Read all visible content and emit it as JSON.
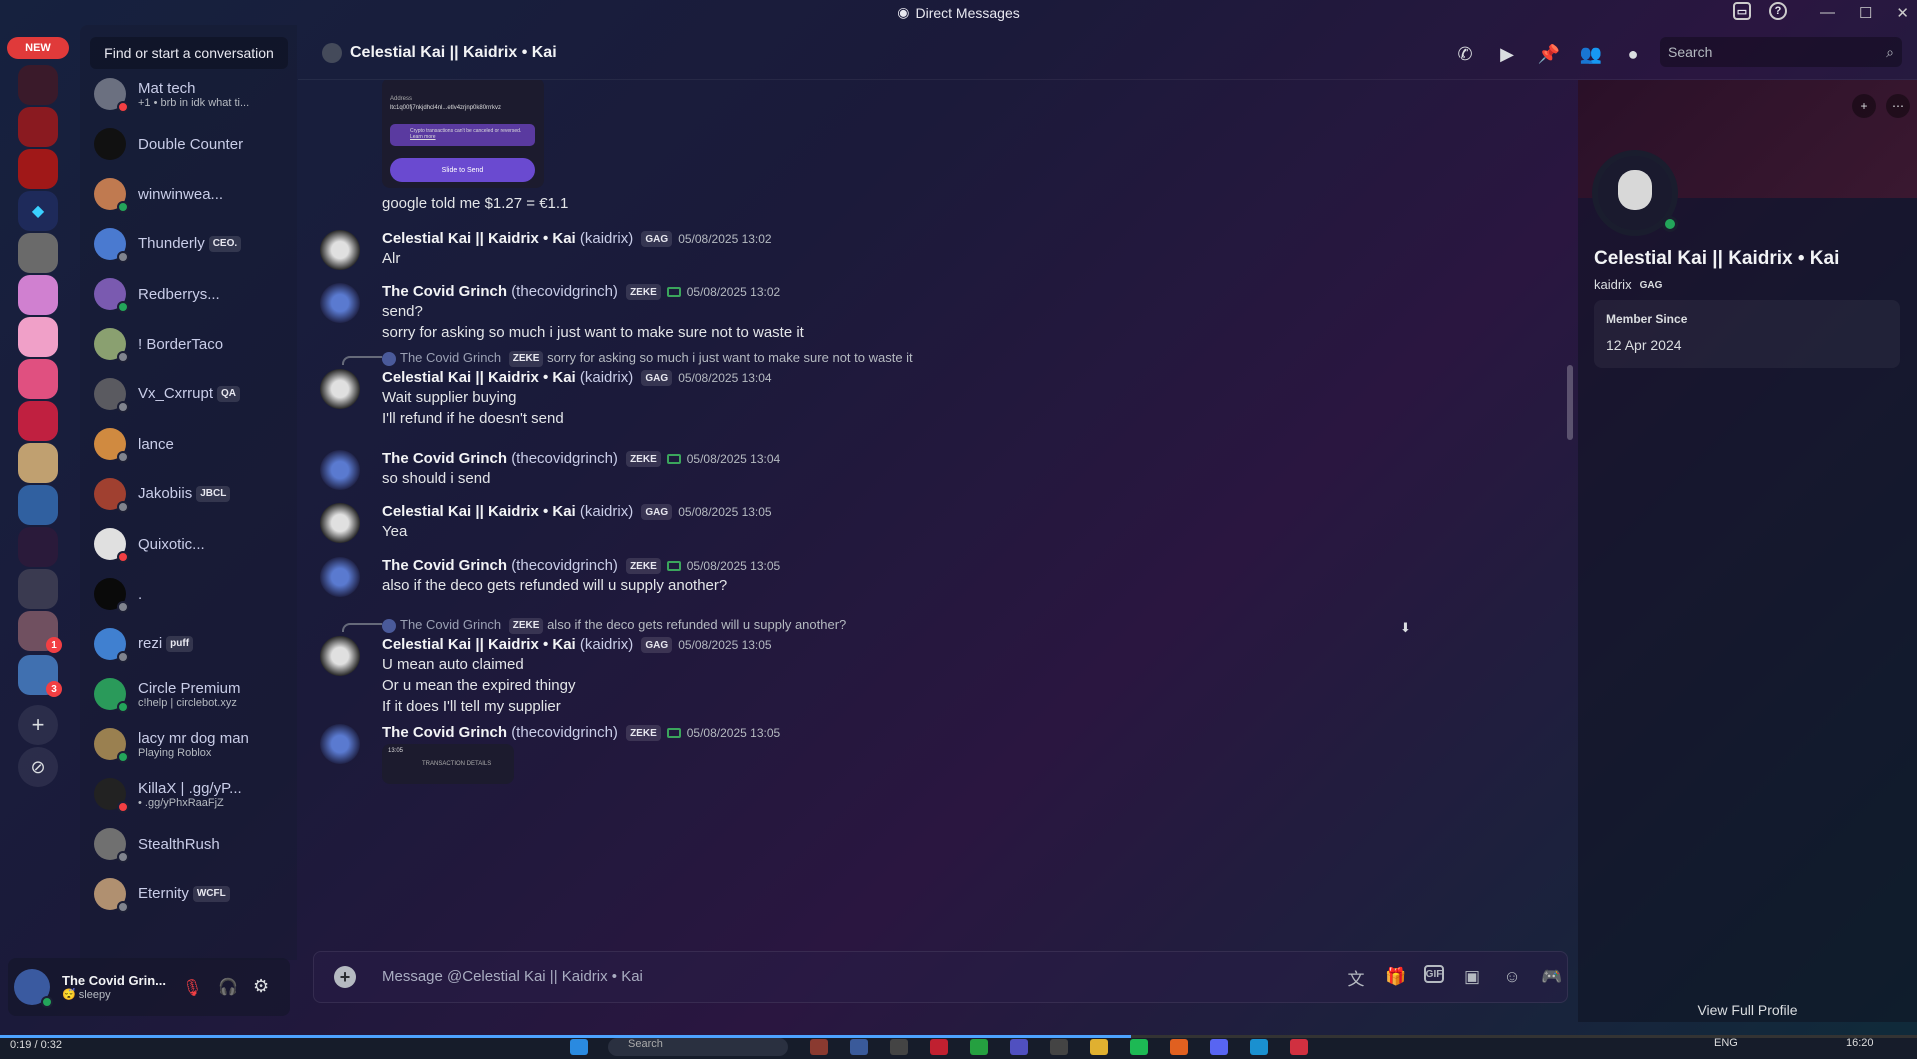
{
  "window": {
    "title": "Direct Messages"
  },
  "servers": {
    "new_label": "NEW",
    "badges": [
      "1",
      "3"
    ]
  },
  "dm_list": {
    "find_placeholder": "Find or start a conversation",
    "items": [
      {
        "name": "Mat tech",
        "sub": "+1 • brb in idk what ti...",
        "status": "dnd",
        "color": "#6b7080"
      },
      {
        "name": "Double Counter",
        "sub": "",
        "status": "none",
        "color": "#111111"
      },
      {
        "name": "winwinwea...",
        "sub": "",
        "status": "on",
        "color": "#c07a50"
      },
      {
        "name": "Thunderly",
        "tag": "CEO.",
        "sub": "",
        "status": "off",
        "color": "#4a7ad0"
      },
      {
        "name": "Redberrys...",
        "sub": "",
        "status": "on",
        "color": "#7a5ab0"
      },
      {
        "name": "! BorderTaco",
        "sub": "",
        "status": "off",
        "color": "#8aa070"
      },
      {
        "name": "Vx_Cxrrupt",
        "tag": "QA",
        "sub": "",
        "status": "off",
        "color": "#5a5a60"
      },
      {
        "name": "lance",
        "sub": "",
        "status": "off",
        "color": "#d08a40"
      },
      {
        "name": "Jakobiis",
        "tag": "JBCL",
        "sub": "",
        "status": "off",
        "color": "#a04030"
      },
      {
        "name": "Quixotic...",
        "sub": "",
        "status": "dnd",
        "color": "#e0e0e0"
      },
      {
        "name": ".",
        "sub": "",
        "status": "off",
        "color": "#0a0a0a"
      },
      {
        "name": "rezi",
        "tag": "puff",
        "sub": "",
        "status": "off",
        "color": "#4080d0"
      },
      {
        "name": "Circle Premium",
        "sub": "c!help | circlebot.xyz",
        "status": "on",
        "color": "#2a9a5a"
      },
      {
        "name": "lacy mr dog man",
        "sub": "Playing Roblox",
        "status": "on",
        "color": "#9a8050"
      },
      {
        "name": "KillaX | .gg/yP...",
        "sub": "• .gg/yPhxRaaFjZ",
        "status": "dnd",
        "color": "#222222"
      },
      {
        "name": "StealthRush",
        "sub": "",
        "status": "off",
        "color": "#707070"
      },
      {
        "name": "Eternity",
        "tag": "WCFL",
        "sub": "",
        "status": "off",
        "color": "#b09070"
      }
    ]
  },
  "user_panel": {
    "name": "The Covid Grin...",
    "status": "sleepy"
  },
  "header": {
    "title": "Celestial Kai || Kaidrix • Kai",
    "search_placeholder": "Search"
  },
  "chat": {
    "top_image": {
      "address_label": "Address",
      "address": "ltc1q00fj7nkjdhcl4nl...etlv4zrjnp0k80rrrkvz",
      "notice": "Crypto transactions can't be canceled or reversed.",
      "learn_more": "Learn more",
      "slide": "Slide to Send"
    },
    "first_line": "google told me $1.27 = €1.1",
    "messages": [
      {
        "author": "Celestial Kai || Kaidrix • Kai",
        "username": "(kaidrix)",
        "tag": "GAG",
        "ts": "05/08/2025 13:02",
        "lines": [
          "Alr"
        ],
        "kind": "kai"
      },
      {
        "author": "The Covid Grinch",
        "username": "(thecovidgrinch)",
        "tag": "ZEKE",
        "ts": "05/08/2025 13:02",
        "lines": [
          "send?",
          "sorry for asking so much i just want to make sure not to waste it"
        ],
        "kind": "grinch"
      },
      {
        "author": "Celestial Kai || Kaidrix • Kai",
        "username": "(kaidrix)",
        "tag": "GAG",
        "ts": "05/08/2025 13:04",
        "lines": [
          "Wait supplier buying",
          "I'll refund if he doesn't send"
        ],
        "kind": "kai",
        "reply": {
          "author": "The Covid Grinch",
          "tag": "ZEKE",
          "text": "sorry for asking so much i just want to make sure not to waste it"
        }
      },
      {
        "author": "The Covid Grinch",
        "username": "(thecovidgrinch)",
        "tag": "ZEKE",
        "ts": "05/08/2025 13:04",
        "lines": [
          "so should i send"
        ],
        "kind": "grinch"
      },
      {
        "author": "Celestial Kai || Kaidrix • Kai",
        "username": "(kaidrix)",
        "tag": "GAG",
        "ts": "05/08/2025 13:05",
        "lines": [
          "Yea"
        ],
        "kind": "kai"
      },
      {
        "author": "The Covid Grinch",
        "username": "(thecovidgrinch)",
        "tag": "ZEKE",
        "ts": "05/08/2025 13:05",
        "lines": [
          "also if the deco gets refunded will u supply another?"
        ],
        "kind": "grinch"
      },
      {
        "author": "Celestial Kai || Kaidrix • Kai",
        "username": "(kaidrix)",
        "tag": "GAG",
        "ts": "05/08/2025 13:05",
        "lines": [
          "U mean auto claimed",
          "Or u mean the expired thingy",
          "If it does I'll tell my supplier"
        ],
        "kind": "kai",
        "reply": {
          "author": "The Covid Grinch",
          "tag": "ZEKE",
          "text": "also if the deco gets refunded will u supply another?"
        }
      },
      {
        "author": "The Covid Grinch",
        "username": "(thecovidgrinch)",
        "tag": "ZEKE",
        "ts": "05/08/2025 13:05",
        "lines": [],
        "kind": "grinch"
      }
    ],
    "bottom_image": {
      "time": "13:05",
      "title": "TRANSACTION DETAILS"
    }
  },
  "composer": {
    "placeholder": "Message @Celestial Kai || Kaidrix • Kai"
  },
  "profile": {
    "display_name": "Celestial Kai || Kaidrix • Kai",
    "username": "kaidrix",
    "tag": "GAG",
    "member_since_label": "Member Since",
    "member_since": "12 Apr 2024",
    "view_full": "View Full Profile"
  },
  "taskbar": {
    "search": "Search",
    "lang": "ENG",
    "time": "16:20",
    "media_time": "0:19 / 0:32"
  },
  "colors": {
    "accent": "#5865f2",
    "online": "#23a55a",
    "dnd": "#f23f43"
  }
}
